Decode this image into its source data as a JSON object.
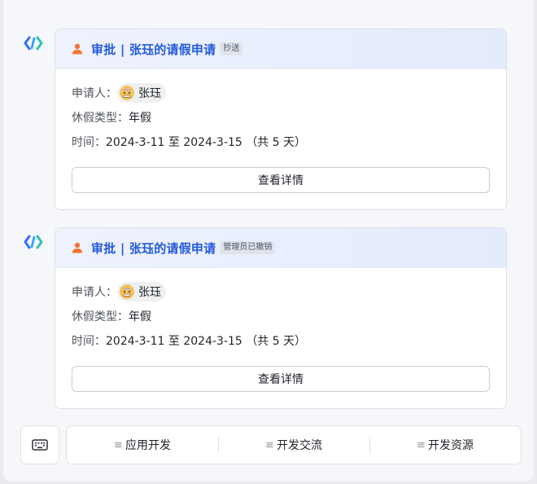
{
  "cards": [
    {
      "title": "审批 | 张珏的请假申请",
      "tag": "抄送",
      "applicant_label": "申请人：",
      "applicant_name": "张珏",
      "leave_type_label": "休假类型：",
      "leave_type_value": "年假",
      "time_label": "时间：",
      "time_value": "2024-3-11 至 2024-3-15 （共 5 天）",
      "button_label": "查看详情"
    },
    {
      "title": "审批 | 张珏的请假申请",
      "tag": "管理员已撤销",
      "applicant_label": "申请人：",
      "applicant_name": "张珏",
      "leave_type_label": "休假类型：",
      "leave_type_value": "年假",
      "time_label": "时间：",
      "time_value": "2024-3-11 至 2024-3-15 （共 5 天）",
      "button_label": "查看详情"
    }
  ],
  "bottom_menu": {
    "keyboard_icon": "keyboard-icon",
    "items": [
      {
        "glyph": "≡",
        "label": "应用开发"
      },
      {
        "glyph": "≡",
        "label": "开发交流"
      },
      {
        "glyph": "≡",
        "label": "开发资源"
      }
    ]
  },
  "colors": {
    "title_blue": "#245bdb",
    "user_icon_orange": "#f77234",
    "header_bg": "#e8eefd"
  }
}
